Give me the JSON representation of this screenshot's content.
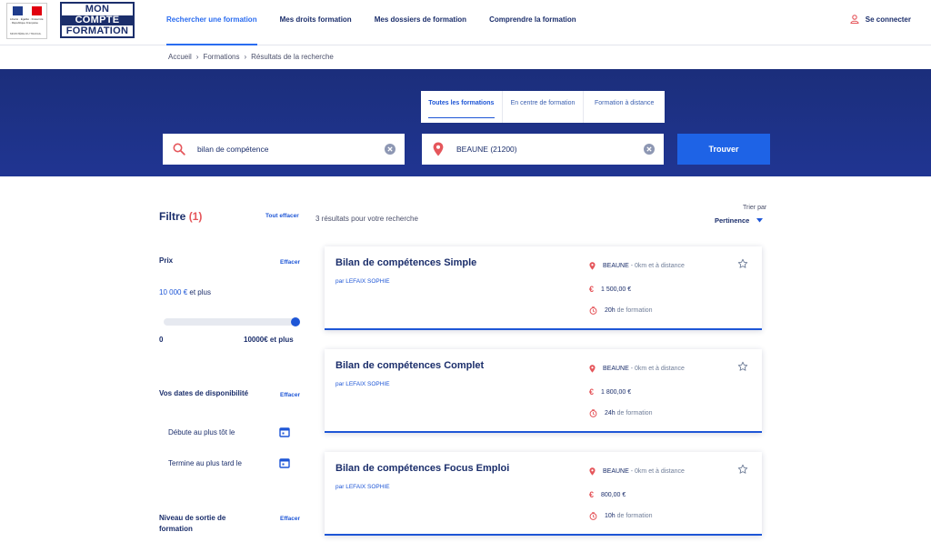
{
  "header": {
    "rf_logo_line1": "Liberté · Égalité · Fraternité · République Française",
    "rf_logo_line2": "MINISTÈRE DU TRAVAIL",
    "mcf_logo": [
      "MON",
      "COMPTE",
      "FORMATION"
    ],
    "nav": [
      "Rechercher une formation",
      "Mes droits formation",
      "Mes dossiers de formation",
      "Comprendre la formation"
    ],
    "login": "Se connecter"
  },
  "breadcrumb": [
    "Accueil",
    "Formations",
    "Résultats de la recherche"
  ],
  "search": {
    "modes": [
      "Toutes les formations",
      "En centre de formation",
      "Formation à distance"
    ],
    "keyword": "bilan de compétence",
    "location": "BEAUNE (21200)",
    "button": "Trouver"
  },
  "filters": {
    "title": "Filtre",
    "count": "(1)",
    "clear_all": "Tout effacer",
    "price": {
      "label": "Prix",
      "clear": "Effacer",
      "amount": "10 000 €",
      "suffix": "et plus",
      "slider_level": 1.0,
      "min": "0",
      "max": "10000€ et plus"
    },
    "dates": {
      "label": "Vos dates de disponibilité",
      "clear": "Effacer",
      "start": "Débute au plus tôt le",
      "end": "Termine au plus tard le"
    },
    "level": {
      "label": "Niveau de sortie de formation",
      "clear": "Effacer"
    }
  },
  "results": {
    "count_text": "3 résultats pour votre recherche",
    "sort_label": "Trier par",
    "sort_value": "Pertinence",
    "items": [
      {
        "title": "Bilan de compétences Simple",
        "org": "par LEFAIX SOPHIE",
        "city": "BEAUNE",
        "distance": "- 0km et à distance",
        "price": "1 500,00 €",
        "hours": "20h",
        "hours_suffix": "de formation"
      },
      {
        "title": "Bilan de compétences Complet",
        "org": "par LEFAIX SOPHIE",
        "city": "BEAUNE",
        "distance": "- 0km et à distance",
        "price": "1 800,00 €",
        "hours": "24h",
        "hours_suffix": "de formation"
      },
      {
        "title": "Bilan de compétences Focus Emploi",
        "org": "par LEFAIX SOPHIE",
        "city": "BEAUNE",
        "distance": "- 0km et à distance",
        "price": "800,00 €",
        "hours": "10h",
        "hours_suffix": "de formation"
      }
    ]
  },
  "colors": {
    "brand_navy": "#1b2e6b",
    "accent_blue": "#1e63e6",
    "accent_red": "#e5565b"
  }
}
